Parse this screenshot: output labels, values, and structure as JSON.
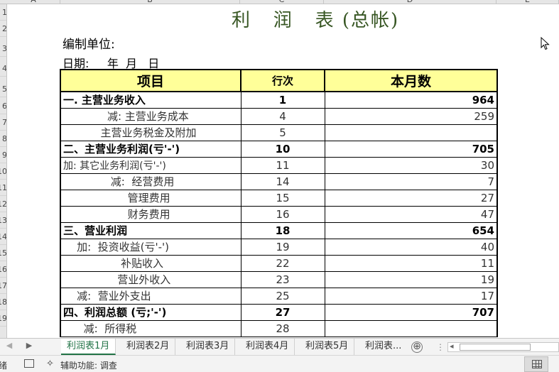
{
  "columns": [
    "A",
    "B",
    "C",
    "D",
    "E"
  ],
  "rows": [
    "1",
    "2",
    "3",
    "4",
    "5",
    "6",
    "7",
    "8",
    "9",
    "10",
    "11",
    "12",
    "13",
    "14",
    "15",
    "16",
    "17",
    "18",
    "19"
  ],
  "sheet": {
    "title": "利   润   表 (总帐)",
    "unit_label": "编制单位:",
    "date_label": "日期:     年  月   日",
    "headers": {
      "item": "项目",
      "line": "行次",
      "month": "本月数"
    },
    "rows": [
      {
        "item": "一. 主营业务收入",
        "line": "1",
        "value": "964"
      },
      {
        "item": "             减: 主营业务成本",
        "line": "4",
        "value": "259"
      },
      {
        "item": "           主营业务税金及附加",
        "line": "5",
        "value": ""
      },
      {
        "item": "二、主营业务利润(亏'-')",
        "line": "10",
        "value": "705"
      },
      {
        "item": "加: 其它业务利润(亏'-')",
        "line": "11",
        "value": "30"
      },
      {
        "item": "              减:  经营费用",
        "line": "14",
        "value": "7"
      },
      {
        "item": "                   管理费用",
        "line": "15",
        "value": "27"
      },
      {
        "item": "                   财务费用",
        "line": "16",
        "value": "47"
      },
      {
        "item": "三、营业利润",
        "line": "18",
        "value": "654"
      },
      {
        "item": "    加:  投资收益(亏'-')",
        "line": "19",
        "value": "40"
      },
      {
        "item": "                 补贴收入",
        "line": "22",
        "value": "11"
      },
      {
        "item": "                营业外收入",
        "line": "23",
        "value": "19"
      },
      {
        "item": "    减:  营业外支出",
        "line": "25",
        "value": "17"
      },
      {
        "item": "四、利润总额 (亏;'-')",
        "line": "27",
        "value": "707"
      },
      {
        "item": "      减:  所得税",
        "line": "28",
        "value": ""
      }
    ]
  },
  "tabs": [
    "利润表1月",
    "利润表2月",
    "利润表3月",
    "利润表4月",
    "利润表5月",
    "利润表"
  ],
  "tab_more": "...",
  "add_sheet": "⊕",
  "status": {
    "mode": "就绪",
    "accessibility": "辅助功能: 调查"
  },
  "colors": {
    "header_fill": "#ffff99",
    "title": "#375623",
    "active_tab": "#217346"
  }
}
